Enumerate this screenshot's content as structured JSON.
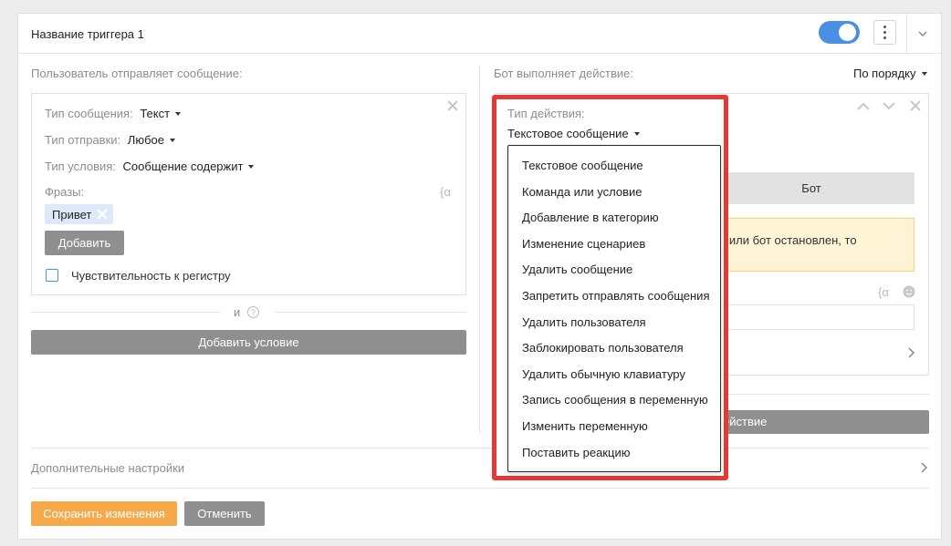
{
  "trigger": {
    "title": "Название триггера 1"
  },
  "left": {
    "heading": "Пользователь отправляет сообщение:",
    "message_type_label": "Тип сообщения:",
    "message_type_value": "Текст",
    "send_type_label": "Тип отправки:",
    "send_type_value": "Любое",
    "condition_type_label": "Тип условия:",
    "condition_type_value": "Сообщение содержит",
    "phrases_label": "Фразы:",
    "phrase_tag": "Привет",
    "add_button": "Добавить",
    "case_sensitive_label": "Чувствительность к регистру",
    "and_separator": "и",
    "add_condition_button": "Добавить условие"
  },
  "right": {
    "heading": "Бот выполняет действие:",
    "order_select": "По порядку",
    "action_type_label": "Тип действия:",
    "action_type_value": "Текстовое сообщение",
    "bot_tab": "Бот",
    "warning_text": "е или бот остановлен, то",
    "add_action_partial": "ействие"
  },
  "dropdown": {
    "options": [
      "Текстовое сообщение",
      "Команда или условие",
      "Добавление в категорию",
      "Изменение сценариев",
      "Удалить сообщение",
      "Запретить отправлять сообщения",
      "Удалить пользователя",
      "Заблокировать пользователя",
      "Удалить обычную клавиатуру",
      "Запись сообщения в переменную",
      "Изменить переменную",
      "Поставить реакцию"
    ]
  },
  "footer": {
    "extra_settings": "Дополнительные настройки",
    "save_button": "Сохранить изменения",
    "cancel_button": "Отменить"
  },
  "colors": {
    "accent": "#4a90e2",
    "save": "#f6a94a",
    "highlight": "#e53935",
    "warning_bg": "#fff5d6",
    "tag_bg": "#dbe9fb"
  }
}
